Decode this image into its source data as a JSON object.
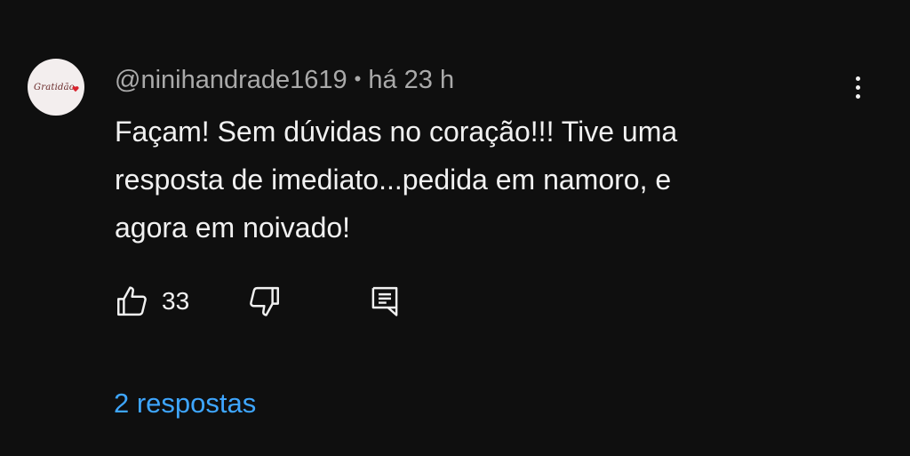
{
  "comment": {
    "avatar_text": "Gratidão",
    "author": "@ninihandrade1619",
    "separator": "•",
    "timestamp": "há 23 h",
    "text_lines": [
      "Façam! Sem dúvidas no coração!!! Tive uma",
      "resposta de imediato...pedida em namoro, e",
      "agora em noivado!"
    ],
    "like_count": "33",
    "replies_label": "2 respostas"
  },
  "icons": {
    "like": "thumbs-up-icon",
    "dislike": "thumbs-down-icon",
    "reply": "reply-comment-icon",
    "menu": "more-vertical-icon"
  },
  "colors": {
    "background": "#0f0f0f",
    "text": "#f1f1f1",
    "secondary_text": "#aaaaaa",
    "link": "#3ea6ff"
  }
}
